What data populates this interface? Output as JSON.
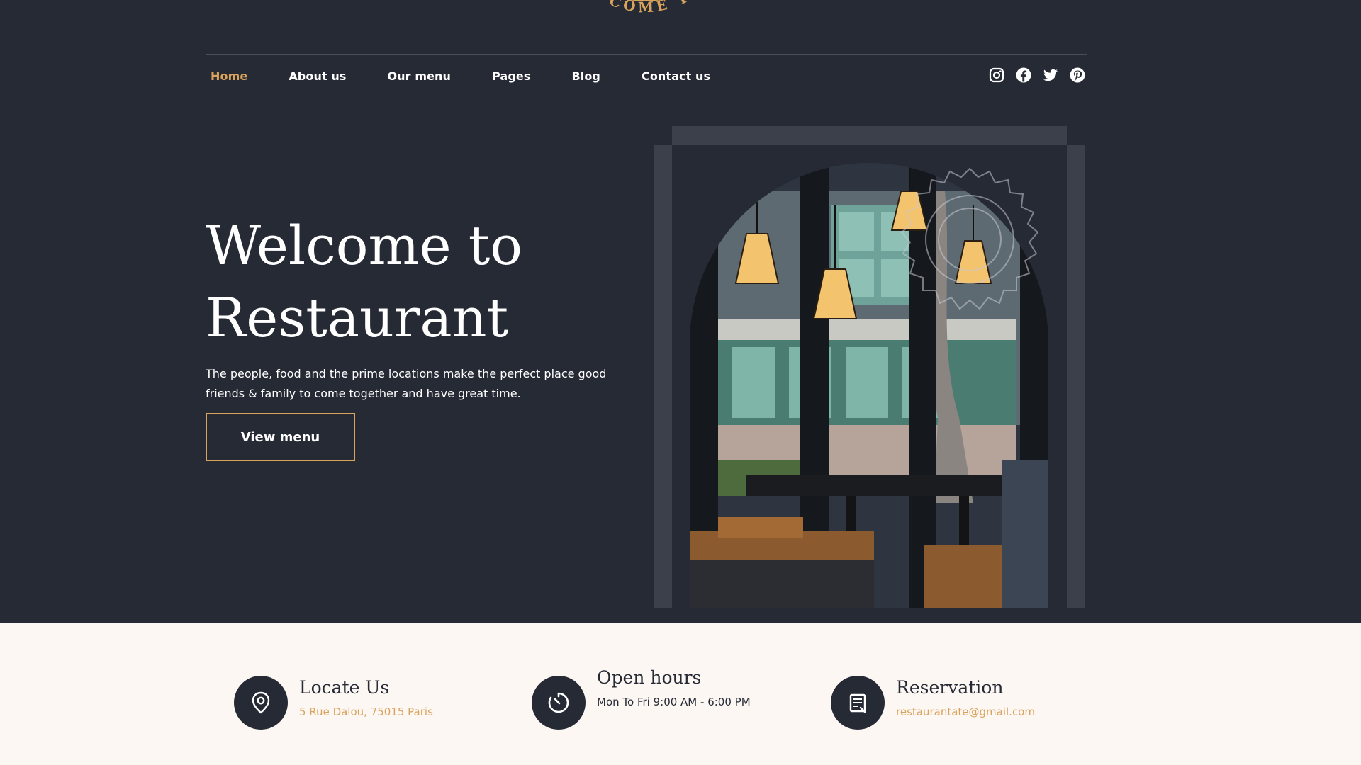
{
  "logo": {
    "arc_text": "COME TO"
  },
  "nav": {
    "items": [
      {
        "label": "Home",
        "active": true
      },
      {
        "label": "About us",
        "active": false
      },
      {
        "label": "Our menu",
        "active": false
      },
      {
        "label": "Pages",
        "active": false
      },
      {
        "label": "Blog",
        "active": false
      },
      {
        "label": "Contact us",
        "active": false
      }
    ]
  },
  "socials": [
    "instagram-icon",
    "facebook-icon",
    "twitter-icon",
    "pinterest-icon"
  ],
  "hero": {
    "title_line1": "Welcome to",
    "title_line2": "Restaurant",
    "text": "The people, food and the prime locations make the perfect place good friends & family to come together and have great time.",
    "button_label": "View menu"
  },
  "info": [
    {
      "icon": "location-pin-icon",
      "title": "Locate Us",
      "sub": "5 Rue Dalou, 75015 Paris",
      "accent": true
    },
    {
      "icon": "clock-icon",
      "title": "Open hours",
      "sub": "Mon To Fri 9:00 AM - 6:00 PM",
      "accent": false
    },
    {
      "icon": "reservation-icon",
      "title": "Reservation",
      "sub": "restaurantate@gmail.com",
      "accent": true
    }
  ],
  "colors": {
    "background": "#262a35",
    "accent": "#d9a35c",
    "frame": "#3c404a",
    "info_background": "#fdf7f4"
  }
}
